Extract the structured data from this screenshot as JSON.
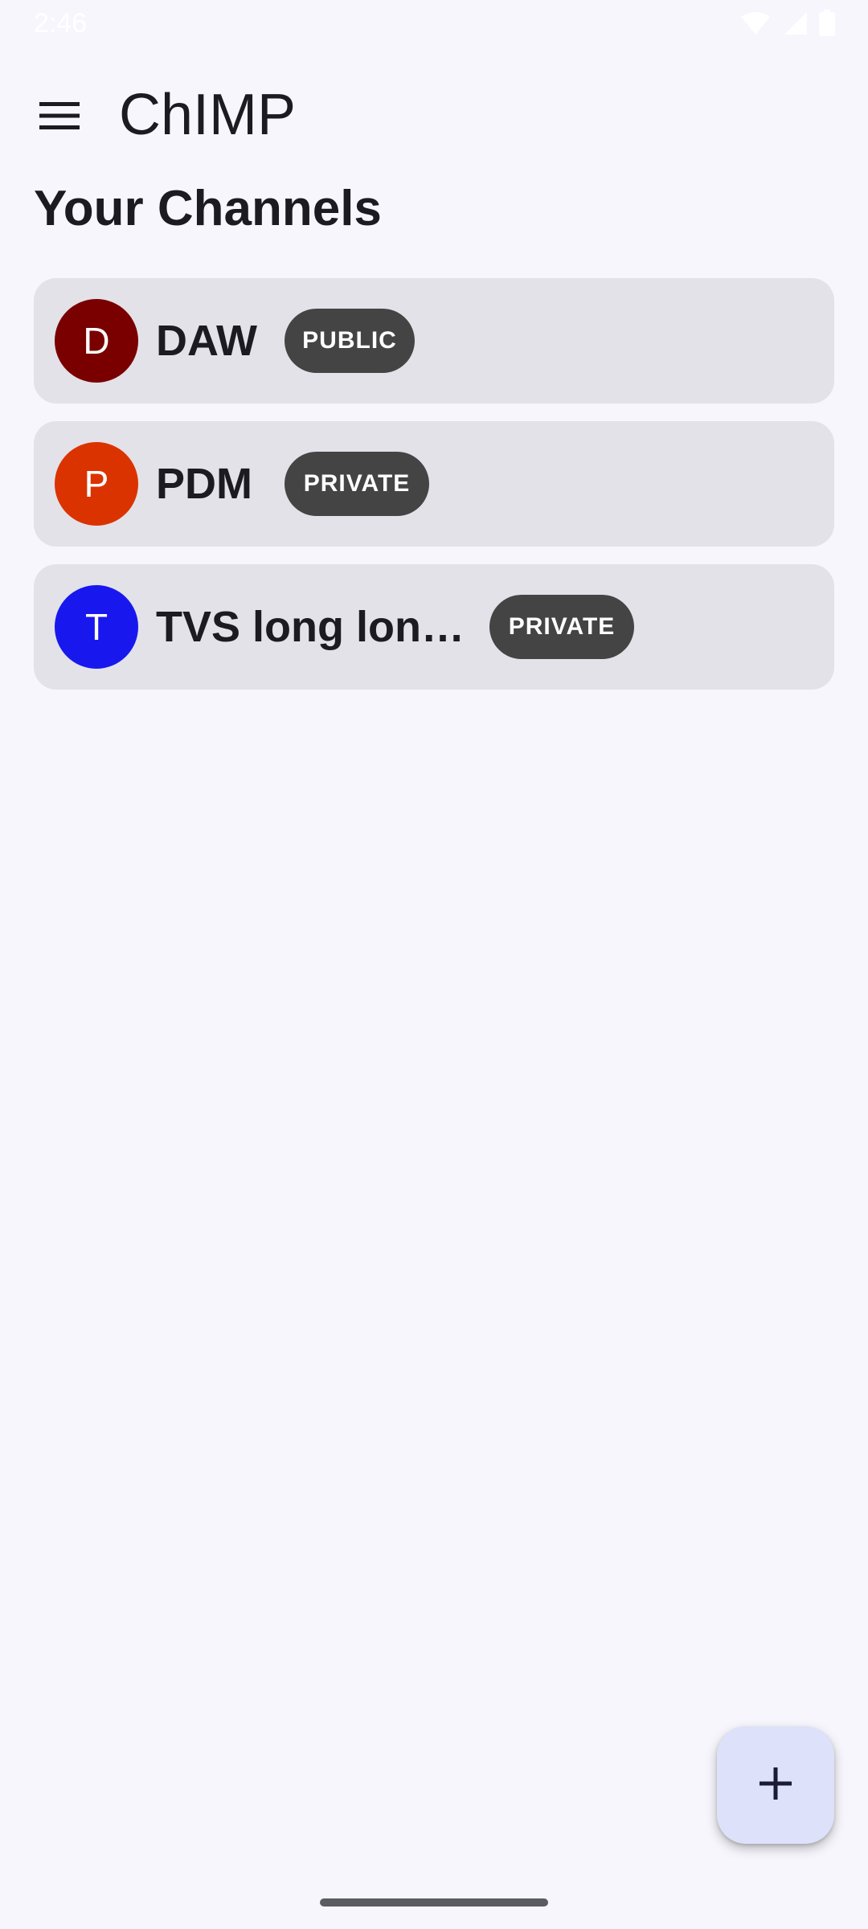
{
  "status_bar": {
    "time": "2:46",
    "icons": [
      "wifi-icon",
      "cellular-signal-icon",
      "battery-icon"
    ]
  },
  "app_bar": {
    "menu_icon": "hamburger-menu-icon",
    "title": "ChIMP"
  },
  "section": {
    "title": "Your Channels"
  },
  "channels": [
    {
      "initial": "D",
      "name": "DAW",
      "visibility": "PUBLIC",
      "avatar_color": "#7a0000"
    },
    {
      "initial": "P",
      "name": "PDM",
      "visibility": "PRIVATE",
      "avatar_color": "#db3300"
    },
    {
      "initial": "T",
      "name": "TVS long lon…",
      "visibility": "PRIVATE",
      "avatar_color": "#1818ee"
    }
  ],
  "fab": {
    "icon": "plus-icon"
  },
  "colors": {
    "background": "#f7f6fc",
    "card": "#e3e2e8",
    "badge": "#444444",
    "fab": "#dde1fa",
    "text": "#1b1b21"
  }
}
